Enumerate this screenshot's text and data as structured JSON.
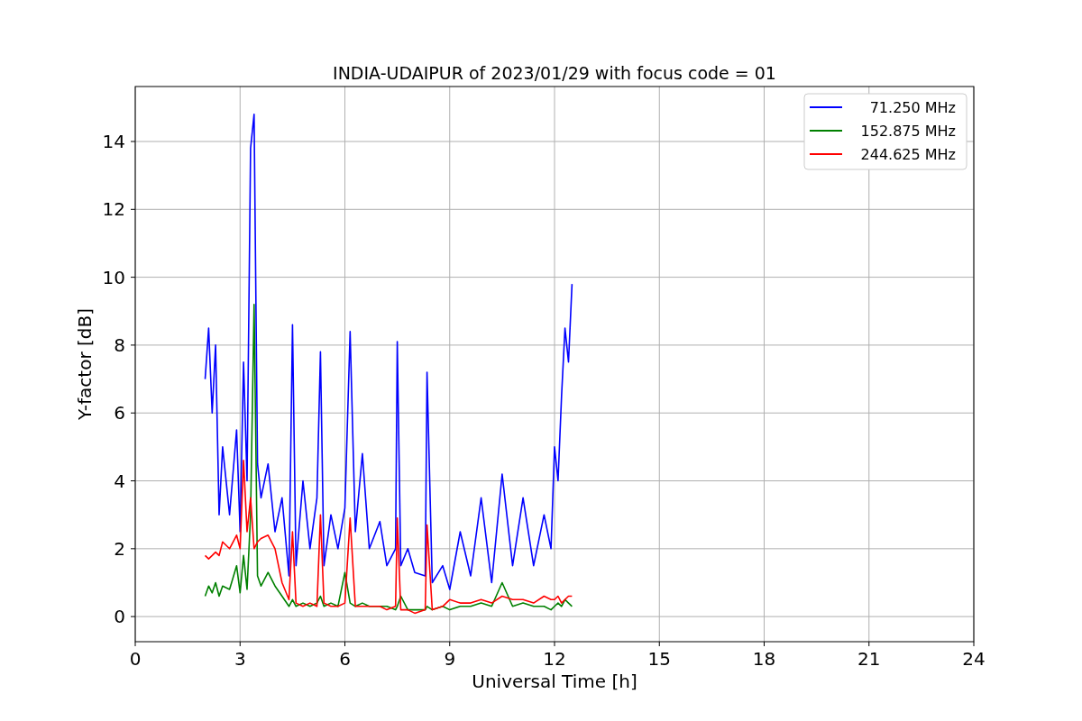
{
  "chart_data": {
    "type": "line",
    "title": "INDIA-UDAIPUR of 2023/01/29 with focus code = 01",
    "xlabel": "Universal Time [h]",
    "ylabel": "Y-factor [dB]",
    "x": [
      2.0,
      2.1,
      2.2,
      2.3,
      2.4,
      2.5,
      2.7,
      2.9,
      3.0,
      3.1,
      3.2,
      3.3,
      3.4,
      3.5,
      3.6,
      3.8,
      4.0,
      4.2,
      4.4,
      4.5,
      4.6,
      4.8,
      5.0,
      5.2,
      5.3,
      5.4,
      5.6,
      5.8,
      6.0,
      6.15,
      6.3,
      6.5,
      6.7,
      7.0,
      7.2,
      7.45,
      7.5,
      7.6,
      7.8,
      8.0,
      8.3,
      8.35,
      8.5,
      8.8,
      9.0,
      9.3,
      9.6,
      9.9,
      10.2,
      10.5,
      10.8,
      11.1,
      11.4,
      11.7,
      11.9,
      12.0,
      12.1,
      12.2,
      12.3,
      12.4,
      12.5
    ],
    "series": [
      {
        "name": "71.250 MHz",
        "color": "#0000ff",
        "values": [
          7.0,
          8.5,
          6.0,
          8.0,
          3.0,
          5.0,
          3.0,
          5.5,
          2.5,
          7.5,
          4.0,
          13.8,
          14.8,
          4.5,
          3.5,
          4.5,
          2.5,
          3.5,
          1.2,
          8.6,
          1.5,
          4.0,
          2.0,
          3.5,
          7.8,
          1.5,
          3.0,
          2.0,
          3.2,
          8.4,
          2.5,
          4.8,
          2.0,
          2.8,
          1.5,
          2.0,
          8.1,
          1.5,
          2.0,
          1.3,
          1.2,
          7.2,
          1.0,
          1.5,
          0.8,
          2.5,
          1.2,
          3.5,
          1.0,
          4.2,
          1.5,
          3.5,
          1.5,
          3.0,
          2.0,
          5.0,
          4.0,
          6.5,
          8.5,
          7.5,
          9.8
        ]
      },
      {
        "name": "152.875 MHz",
        "color": "#008000",
        "values": [
          0.6,
          0.9,
          0.7,
          1.0,
          0.6,
          0.9,
          0.8,
          1.5,
          0.7,
          1.8,
          0.8,
          3.0,
          9.2,
          1.2,
          0.9,
          1.3,
          0.9,
          0.6,
          0.3,
          0.5,
          0.3,
          0.4,
          0.3,
          0.4,
          0.6,
          0.3,
          0.4,
          0.3,
          1.3,
          0.4,
          0.3,
          0.4,
          0.3,
          0.3,
          0.3,
          0.2,
          0.3,
          0.6,
          0.2,
          0.2,
          0.2,
          0.3,
          0.2,
          0.3,
          0.2,
          0.3,
          0.3,
          0.4,
          0.3,
          1.0,
          0.3,
          0.4,
          0.3,
          0.3,
          0.2,
          0.3,
          0.4,
          0.3,
          0.5,
          0.4,
          0.3
        ]
      },
      {
        "name": "244.625 MHz",
        "color": "#ff0000",
        "values": [
          1.8,
          1.7,
          1.8,
          1.9,
          1.8,
          2.2,
          2.0,
          2.4,
          2.0,
          4.6,
          2.5,
          3.5,
          2.0,
          2.2,
          2.3,
          2.4,
          2.0,
          1.0,
          0.5,
          2.5,
          0.4,
          0.3,
          0.4,
          0.3,
          3.0,
          0.4,
          0.3,
          0.3,
          0.4,
          2.9,
          0.3,
          0.3,
          0.3,
          0.3,
          0.2,
          0.3,
          2.9,
          0.2,
          0.2,
          0.1,
          0.2,
          2.7,
          0.2,
          0.3,
          0.5,
          0.4,
          0.4,
          0.5,
          0.4,
          0.6,
          0.5,
          0.5,
          0.4,
          0.6,
          0.5,
          0.5,
          0.6,
          0.4,
          0.5,
          0.6,
          0.6
        ]
      }
    ],
    "xlim": [
      0,
      24
    ],
    "ylim": [
      -0.74,
      15.62
    ],
    "grid": true,
    "legend": true,
    "xticks": [
      0,
      3,
      6,
      9,
      12,
      15,
      18,
      21,
      24
    ],
    "yticks": [
      0,
      2,
      4,
      6,
      8,
      10,
      12,
      14
    ]
  }
}
